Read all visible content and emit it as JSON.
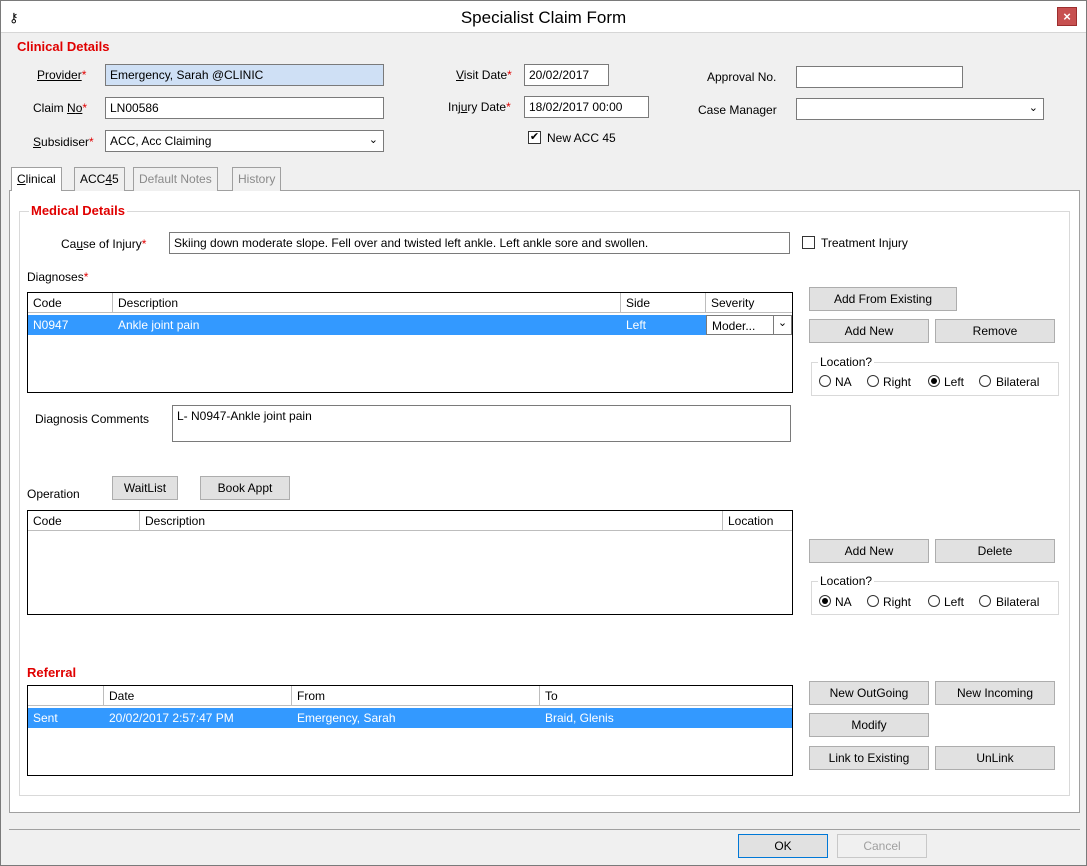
{
  "window": {
    "title": "Specialist Claim Form",
    "key_icon": "⚷",
    "close_icon": "×"
  },
  "clinical_details": {
    "heading": "Clinical Details",
    "provider": {
      "label": "Provider",
      "value": "Emergency, Sarah @CLINIC"
    },
    "claim_no": {
      "label_pre": "Claim ",
      "label_accel": "N",
      "label_post": "o",
      "value": "LN00586"
    },
    "subsidiser": {
      "label_accel": "S",
      "label_post": "ubsidiser",
      "value": "ACC, Acc Claiming"
    },
    "visit_date": {
      "label_accel": "V",
      "label_post": "isit Date",
      "value": "20/02/2017"
    },
    "injury_date": {
      "label_pre": "Inj",
      "label_accel": "u",
      "label_post": "ry Date",
      "value": "18/02/2017 00:00"
    },
    "new_acc45": {
      "label": "New ACC 45",
      "checked": "✔"
    },
    "approval_no": {
      "label": "Approval No.",
      "value": ""
    },
    "case_manager": {
      "label": "Case Manager",
      "value": ""
    },
    "required_mark": "*",
    "dropdown_arrow": "⌄"
  },
  "tabs": [
    {
      "accel": "C",
      "rest": "linical"
    },
    {
      "pre": "ACC",
      "accel": "4",
      "rest": "5"
    },
    {
      "label": "Default Notes"
    },
    {
      "label": "History"
    }
  ],
  "medical_details": {
    "heading": "Medical Details",
    "cause_label_pre": "Ca",
    "cause_label_accel": "u",
    "cause_label_post": "se of Injury",
    "cause_value": "Skiing down moderate slope. Fell over and twisted left ankle. Left ankle sore and swollen.",
    "treatment_injury": "Treatment Injury",
    "diagnoses_label": "Diagnoses",
    "diag_columns": [
      "Code",
      "Description",
      "Side",
      "Severity"
    ],
    "diag_rows": [
      {
        "code": "N0947",
        "description": "Ankle joint pain",
        "side": "Left",
        "severity": "Moder..."
      }
    ],
    "add_from_existing": "Add From Existing",
    "add_new": "Add New",
    "remove": "Remove",
    "location_label": "Location?",
    "location_options": [
      "NA",
      "Right",
      "Left",
      "Bilateral"
    ],
    "diag_location_selected": "Left",
    "diagnosis_comments_label": "Diagnosis Comments",
    "diagnosis_comments_value": "L- N0947-Ankle joint pain"
  },
  "operation": {
    "label": "Operation",
    "waitlist": "WaitList",
    "book_appt": "Book Appt",
    "columns": [
      "Code",
      "Description",
      "Location"
    ],
    "add_new": "Add New",
    "delete": "Delete",
    "location_selected": "NA"
  },
  "referral": {
    "heading": "Referral",
    "columns": [
      "",
      "Date",
      "From",
      "To"
    ],
    "rows": [
      {
        "status": "Sent",
        "date": "20/02/2017 2:57:47 PM",
        "from": "Emergency, Sarah",
        "to": "Braid, Glenis"
      }
    ],
    "new_outgoing": "New OutGoing",
    "new_incoming": "New Incoming",
    "modify": "Modify",
    "link_to_existing": "Link to Existing",
    "unlink": "UnLink"
  },
  "footer": {
    "ok": "OK",
    "cancel": "Cancel"
  }
}
